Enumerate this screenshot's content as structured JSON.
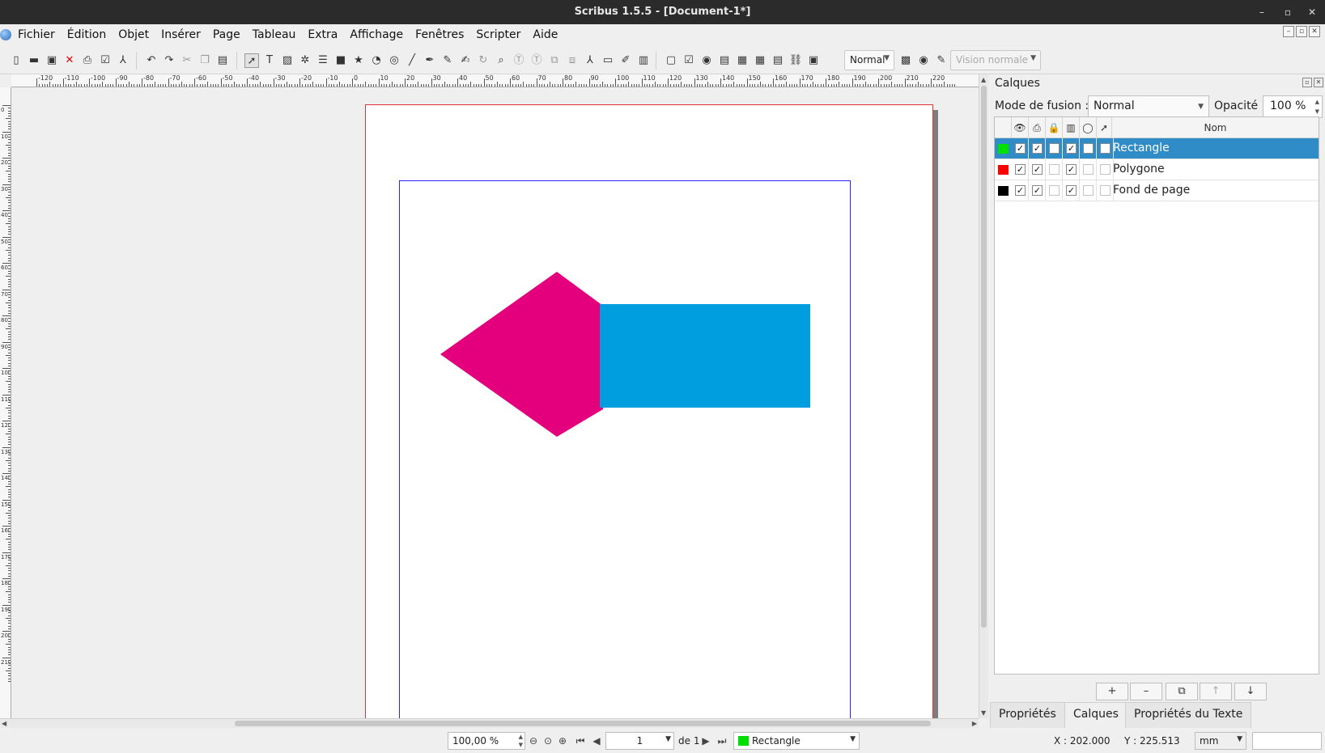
{
  "window": {
    "title": "Scribus 1.5.5 - [Document-1*]",
    "controls": [
      "–",
      "▫",
      "✕"
    ]
  },
  "menu": {
    "items": [
      "Fichier",
      "Édition",
      "Objet",
      "Insérer",
      "Page",
      "Tableau",
      "Extra",
      "Affichage",
      "Fenêtres",
      "Scripter",
      "Aide"
    ]
  },
  "toolbar": {
    "render_mode": "Normal",
    "vision_mode": "Vision normale"
  },
  "ruler": {
    "h_labels": [
      "-120",
      "-110",
      "-100",
      "-90",
      "-80",
      "-70",
      "-60",
      "-50",
      "-40",
      "-30",
      "-20",
      "-10",
      "0",
      "10",
      "20",
      "30",
      "40",
      "50",
      "60",
      "70",
      "80",
      "90",
      "100",
      "110",
      "120",
      "130",
      "140",
      "150",
      "160",
      "170",
      "180",
      "190",
      "200",
      "210",
      "220"
    ],
    "v_labels": [
      "0",
      "10",
      "20",
      "30",
      "40",
      "50",
      "60",
      "70",
      "80",
      "90",
      "100",
      "110",
      "120",
      "130",
      "140",
      "150",
      "160",
      "170",
      "180",
      "190",
      "200",
      "210"
    ]
  },
  "canvas": {
    "polygon_color": "#e4007c",
    "rectangle_color": "#009ddf"
  },
  "panel": {
    "title": "Calques",
    "blend_label": "Mode de fusion :",
    "blend_value": "Normal",
    "opacity_label": "Opacité :",
    "opacity_value": "100 %",
    "column_name": "Nom",
    "layers": [
      {
        "name": "Rectangle",
        "color": "#00e000",
        "visible": true,
        "printable": true,
        "locked": false,
        "flow": true,
        "outline": false,
        "selectable": false,
        "selected": true
      },
      {
        "name": "Polygone",
        "color": "#ff0000",
        "visible": true,
        "printable": true,
        "locked": false,
        "flow": true,
        "outline": false,
        "selectable": false,
        "selected": false
      },
      {
        "name": "Fond de page",
        "color": "#000000",
        "visible": true,
        "printable": true,
        "locked": false,
        "flow": true,
        "outline": false,
        "selectable": false,
        "selected": false
      }
    ],
    "buttons": [
      "+",
      "–",
      "⧉",
      "↑",
      "↓"
    ],
    "tabs": [
      "Propriétés",
      "Calques",
      "Propriétés du Texte"
    ],
    "active_tab": "Calques"
  },
  "status": {
    "zoom": "100,00 %",
    "page": "1",
    "page_of": "de 1",
    "layer": "Rectangle",
    "layer_color": "#00e000",
    "x": "X : 202.000",
    "y": "Y : 225.513",
    "unit": "mm"
  }
}
